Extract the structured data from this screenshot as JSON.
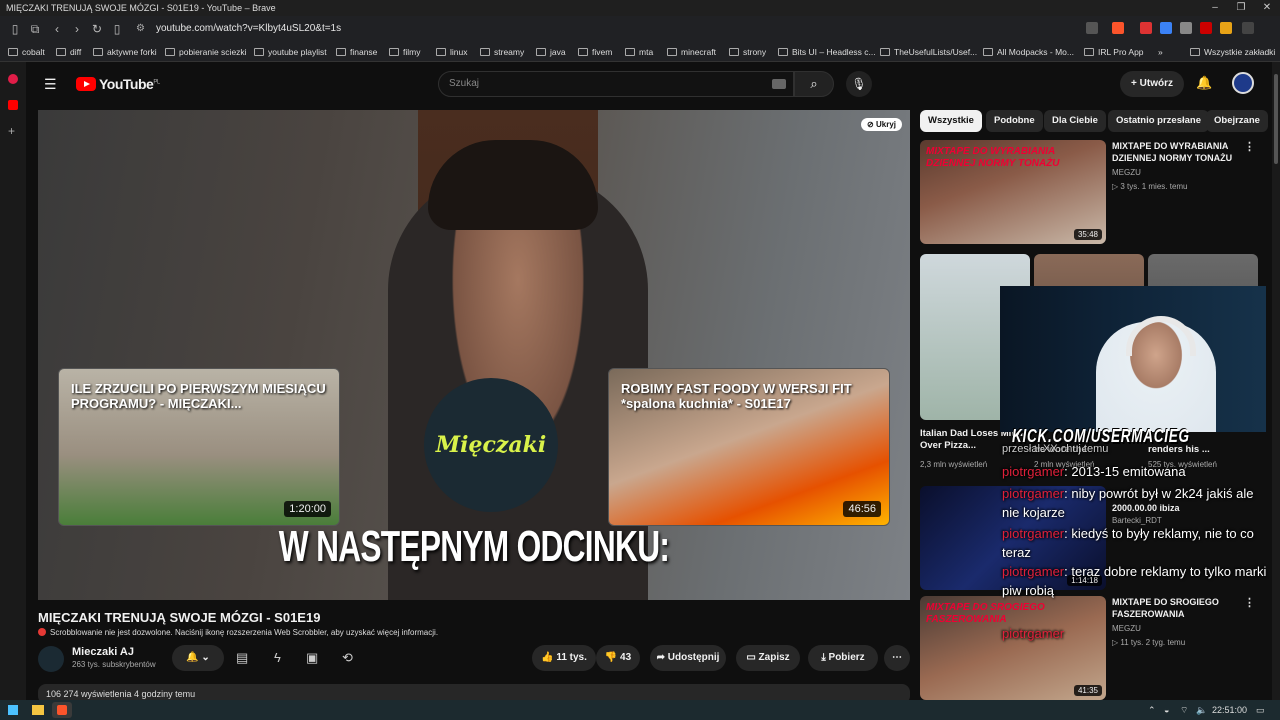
{
  "window": {
    "title": "MIĘCZAKI TRENUJĄ SWOJE MÓZGI - S01E19 - YouTube – Brave",
    "controls": [
      "–",
      "❐",
      "✕"
    ]
  },
  "browser": {
    "url": "youtube.com/watch?v=Klbyt4uSL20&t=1s",
    "bookmarks": [
      "cobalt",
      "diff",
      "aktywne forki",
      "pobieranie sciezki",
      "youtube playlist",
      "finanse",
      "filmy",
      "linux",
      "streamy",
      "java",
      "fivem",
      "mta",
      "minecraft",
      "strony",
      "Bits UI – Headless c...",
      "TheUsefulLists/Usef...",
      "All Modpacks - Mo...",
      "IRL Pro App",
      "»",
      "Wszystkie zakładki"
    ]
  },
  "youtube": {
    "logo": "YouTube",
    "logo_region": "PL",
    "search_placeholder": "Szukaj",
    "create_label": "Utwórz",
    "hide_label": "Ukryj"
  },
  "player": {
    "endcard_left_title": "ILE ZRZUCILI PO PIERWSZYM MIESIĄCU PROGRAMU? - MIĘCZAKI...",
    "endcard_left_duration": "1:20:00",
    "endcard_right_title": "ROBIMY FAST FOODY W WERSJI FIT *spalona kuchnia* - S01E17",
    "endcard_right_duration": "46:56",
    "channel_logo_text": "Mięczaki",
    "overlay_text": "W NASTĘPNYM ODCINKU:"
  },
  "video": {
    "title": "MIĘCZAKI TRENUJĄ SWOJE MÓZGI - S01E19",
    "scrobbler_notice": "Scrobblowanie nie jest dozwolone. Naciśnij ikonę rozszerzenia Web Scrobbler, aby uzyskać więcej informacji.",
    "channel_name": "Mieczaki AJ",
    "channel_subs": "263 tys. subskrybentów",
    "likes": "11 tys.",
    "dislikes": "43",
    "share_label": "Udostępnij",
    "save_label": "Zapisz",
    "download_label": "Pobierz",
    "views_line": "106 274 wyświetlenia  4 godziny temu"
  },
  "chips": [
    "Wszystkie",
    "Podobne",
    "Dla Ciebie",
    "Ostatnio przesłane",
    "Obejrzane"
  ],
  "sidebar": [
    {
      "title": "MIXTAPE DO WYRABIANIA DZIENNEJ NORMY TONAŻU",
      "channel": "MEGZU",
      "meta": "▷ 3 tys.  1 mies. temu",
      "duration": "35:48"
    },
    {
      "title": "Italian Dad Loses Mind Over Pizza...",
      "channel": "",
      "meta": "2,3 mln wyświetleń",
      "duration": ""
    },
    {
      "title": "MIXTAPE DO SROGIEGO FASZEROWANIA",
      "channel": "MEGZU",
      "meta": "▷ 11 tys.  2 tyg. temu",
      "duration": "41:35"
    }
  ],
  "sidebar_partial": {
    "col2_title": "he wore the",
    "col2_meta": "2 mln wyświetleń",
    "col3_title": "renders his ...",
    "col3_meta": "525 tys. wyświetleń",
    "item_channel": "Bartecki_RDT",
    "item_title": "2000.00.00 ibiza",
    "item_duration": "1:14:18"
  },
  "stream_overlay": {
    "kick_handle": "KICK.COM/USERMACIEG",
    "chat": [
      {
        "user": "",
        "text": "przesłał XX chuj temu"
      },
      {
        "user": "piotrgamer",
        "text": ": 2013-15 emitowana"
      },
      {
        "user": "piotrgamer",
        "text": ": niby powrót był w 2k24 jakiś ale nie kojarze"
      },
      {
        "user": "piotrgamer",
        "text": ": kiedyś to były reklamy, nie to co teraz"
      },
      {
        "user": "piotrgamer",
        "text": ": teraz dobre reklamy to tylko marki piw robią"
      },
      {
        "user": "piotrgamer",
        "text": ""
      }
    ]
  },
  "taskbar": {
    "time": "22:51:00"
  },
  "colors": {
    "brand_red": "#ff0000",
    "chat_user": "#e0203a",
    "kick_green": "#53fc18"
  }
}
